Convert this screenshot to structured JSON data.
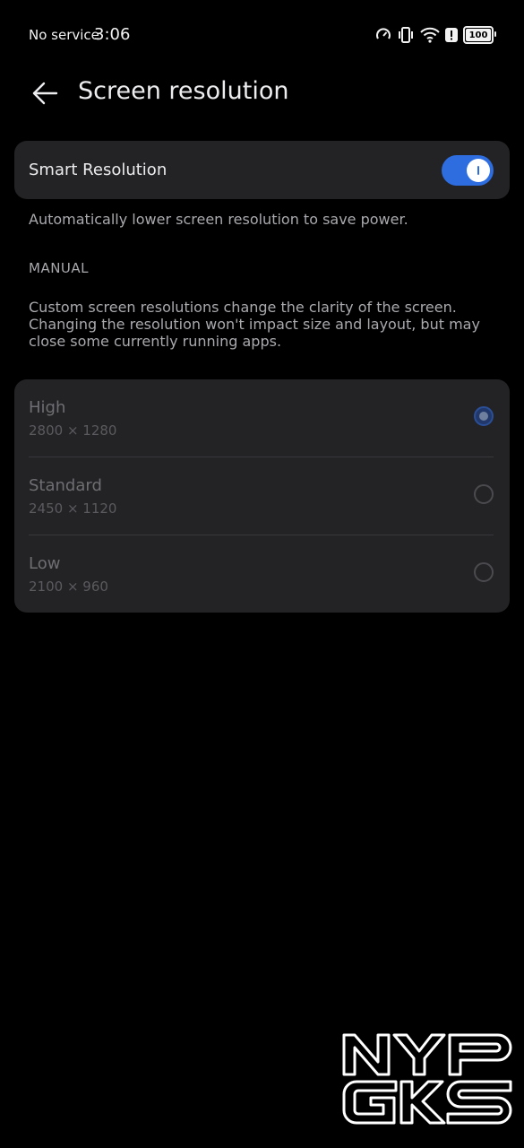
{
  "status_bar": {
    "carrier": "No service",
    "time": "3:06",
    "battery": "100",
    "icons": [
      "speed-icon",
      "vibrate-icon",
      "wifi-icon",
      "alert-icon",
      "battery-icon"
    ]
  },
  "header": {
    "title": "Screen resolution",
    "back_icon": "back-arrow-icon"
  },
  "smart_resolution": {
    "label": "Smart Resolution",
    "enabled": true,
    "description": "Automatically lower screen resolution to save power."
  },
  "manual": {
    "section_label": "MANUAL",
    "description": "Custom screen resolutions change the clarity of the screen. Changing the resolution won't impact size and layout, but may close some currently running apps.",
    "options": [
      {
        "name": "High",
        "value": "2800 × 1280",
        "selected": true
      },
      {
        "name": "Standard",
        "value": "2450 × 1120",
        "selected": false
      },
      {
        "name": "Low",
        "value": "2100 × 960",
        "selected": false
      }
    ]
  },
  "watermark": {
    "line1": "NYP",
    "line2": "GKS"
  },
  "colors": {
    "accent": "#2d6de0",
    "card_background": "#232325",
    "page_background": "#000000"
  }
}
